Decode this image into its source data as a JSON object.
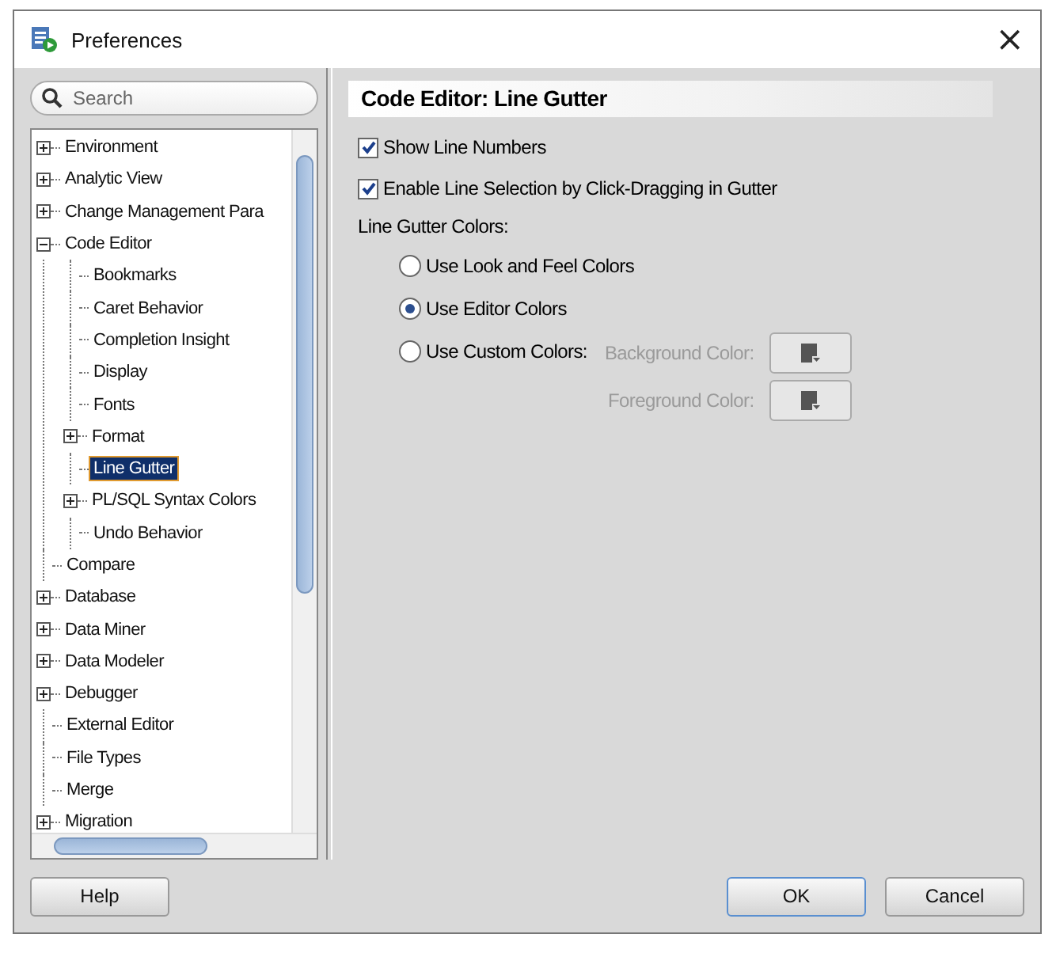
{
  "window": {
    "title": "Preferences",
    "close": "×"
  },
  "search": {
    "placeholder": "Search"
  },
  "tree": [
    {
      "label": "Environment",
      "kind": "group",
      "expanded": false,
      "selected": false
    },
    {
      "label": "Analytic View",
      "kind": "group",
      "expanded": false,
      "selected": false
    },
    {
      "label": "Change Management Para",
      "kind": "group",
      "expanded": false,
      "selected": false
    },
    {
      "label": "Code Editor",
      "kind": "group",
      "expanded": true,
      "selected": false,
      "children": [
        {
          "label": "Bookmarks",
          "kind": "leaf",
          "selected": false
        },
        {
          "label": "Caret Behavior",
          "kind": "leaf",
          "selected": false
        },
        {
          "label": "Completion Insight",
          "kind": "leaf",
          "selected": false
        },
        {
          "label": "Display",
          "kind": "leaf",
          "selected": false
        },
        {
          "label": "Fonts",
          "kind": "leaf",
          "selected": false
        },
        {
          "label": "Format",
          "kind": "group",
          "expanded": false,
          "selected": false
        },
        {
          "label": "Line Gutter",
          "kind": "leaf",
          "selected": true
        },
        {
          "label": "PL/SQL Syntax Colors",
          "kind": "group",
          "expanded": false,
          "selected": false
        },
        {
          "label": "Undo Behavior",
          "kind": "leaf",
          "selected": false
        }
      ]
    },
    {
      "label": "Compare",
      "kind": "leaf",
      "selected": false
    },
    {
      "label": "Database",
      "kind": "group",
      "expanded": false,
      "selected": false
    },
    {
      "label": "Data Miner",
      "kind": "group",
      "expanded": false,
      "selected": false
    },
    {
      "label": "Data Modeler",
      "kind": "group",
      "expanded": false,
      "selected": false
    },
    {
      "label": "Debugger",
      "kind": "group",
      "expanded": false,
      "selected": false
    },
    {
      "label": "External Editor",
      "kind": "leaf",
      "selected": false
    },
    {
      "label": "File Types",
      "kind": "leaf",
      "selected": false
    },
    {
      "label": "Merge",
      "kind": "leaf",
      "selected": false
    },
    {
      "label": "Migration",
      "kind": "group",
      "expanded": false,
      "selected": false
    }
  ],
  "panel": {
    "title": "Code Editor: Line Gutter",
    "checkboxes": [
      {
        "label": "Show Line Numbers",
        "checked": true
      },
      {
        "label": "Enable Line Selection by Click-Dragging in Gutter",
        "checked": true
      }
    ],
    "group_label": "Line Gutter Colors:",
    "radios": [
      {
        "label": "Use Look and Feel Colors",
        "selected": false
      },
      {
        "label": "Use Editor Colors",
        "selected": true
      },
      {
        "label": "Use Custom Colors:",
        "selected": false
      }
    ],
    "color_fields": [
      {
        "label": "Background Color:",
        "disabled": true
      },
      {
        "label": "Foreground Color:",
        "disabled": true
      }
    ]
  },
  "buttons": {
    "help": "Help",
    "ok": "OK",
    "cancel": "Cancel"
  }
}
